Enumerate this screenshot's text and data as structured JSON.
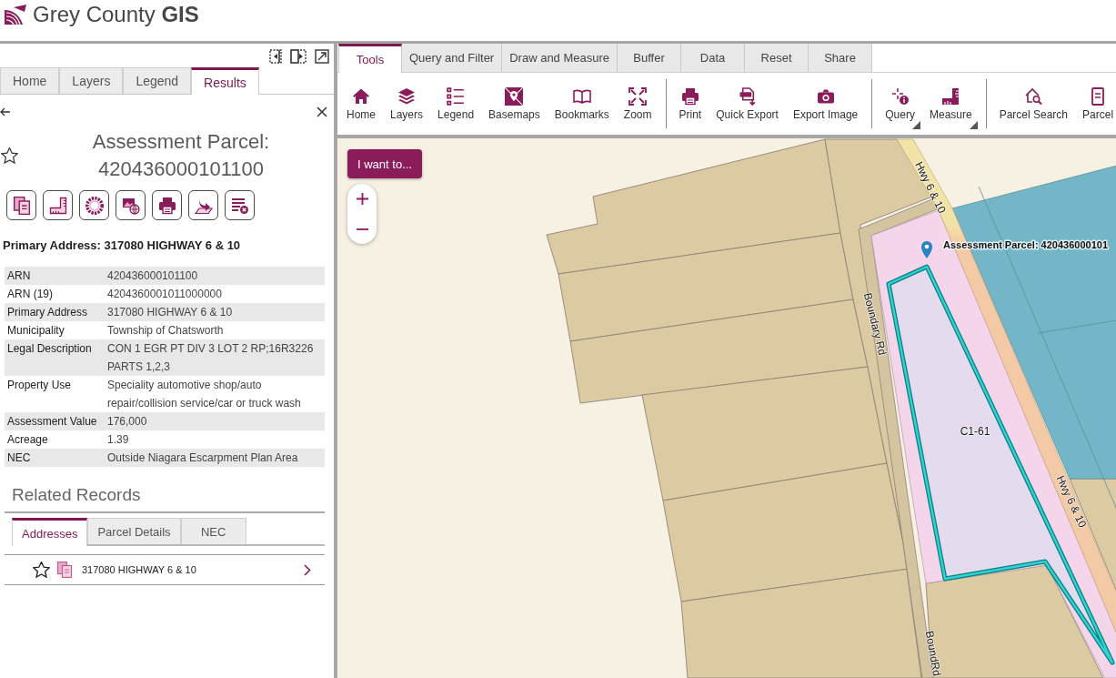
{
  "header": {
    "title": "Grey County **GIS**"
  },
  "side_panel": {
    "tabs": [
      {
        "label": "Home",
        "selected": false
      },
      {
        "label": "Layers",
        "selected": false
      },
      {
        "label": "Legend",
        "selected": false
      },
      {
        "label": "Results",
        "selected": true
      }
    ],
    "record": {
      "title": "Assessment Parcel: 420436000101100",
      "starred": false
    },
    "summary": "Primary Address: 317080 HIGHWAY 6 & 10",
    "attributes": [
      {
        "label": "ARN",
        "value": "420436000101100"
      },
      {
        "label": "ARN (19)",
        "value": "4204360001011000000"
      },
      {
        "label": "Primary Address",
        "value": "317080 HIGHWAY 6 & 10"
      },
      {
        "label": "Municipality",
        "value": "Township of Chatsworth"
      },
      {
        "label": "Legal Description",
        "value": "CON 1 EGR PT DIV 3 LOT 2 RP;16R3226 PARTS 1,2,3"
      },
      {
        "label": "Property Use",
        "value": "Speciality automotive shop/auto repair/collision service/car or truck wash"
      },
      {
        "label": "Assessment Value",
        "value": "176,000"
      },
      {
        "label": "Acreage",
        "value": "1.39"
      },
      {
        "label": "NEC",
        "value": "Outside Niagara Escarpment Plan Area"
      }
    ]
  },
  "related_records": {
    "title": "Related Records",
    "tabs": [
      {
        "label": "Addresses",
        "selected": true
      },
      {
        "label": "Parcel Details",
        "selected": false
      },
      {
        "label": "NEC",
        "selected": false
      }
    ],
    "items": [
      {
        "text": "317080 HIGHWAY 6 & 10",
        "starred": false
      }
    ]
  },
  "toolbar": {
    "tabs": [
      {
        "label": "Tools",
        "selected": true
      },
      {
        "label": "Query and Filter",
        "selected": false
      },
      {
        "label": "Draw and Measure",
        "selected": false
      },
      {
        "label": "Buffer",
        "selected": false
      },
      {
        "label": "Data",
        "selected": false
      },
      {
        "label": "Reset",
        "selected": false
      },
      {
        "label": "Share",
        "selected": false
      }
    ],
    "tool_groups": [
      [
        {
          "label": "Home",
          "menu": false
        },
        {
          "label": "Layers",
          "menu": false
        },
        {
          "label": "Legend",
          "menu": false
        },
        {
          "label": "Basemaps",
          "menu": false
        },
        {
          "label": "Bookmarks",
          "menu": false
        },
        {
          "label": "Zoom",
          "menu": false
        }
      ],
      [
        {
          "label": "Print",
          "menu": false
        },
        {
          "label": "Quick Export",
          "menu": false
        },
        {
          "label": "Export Image",
          "menu": false
        }
      ],
      [
        {
          "label": "Query",
          "menu": true
        },
        {
          "label": "Measure",
          "menu": true
        }
      ],
      [
        {
          "label": "Parcel Search",
          "menu": false
        },
        {
          "label": "Parcel",
          "menu": false
        }
      ]
    ]
  },
  "map": {
    "action_button": "I want to...",
    "labels": [
      {
        "kind": "road",
        "text": "Hwy 6 & 10"
      },
      {
        "kind": "parcel",
        "text": "Assessment Parcel: 420436000101"
      },
      {
        "kind": "road",
        "text": "Boundary Rd"
      },
      {
        "kind": "zone",
        "text": "C1-61"
      },
      {
        "kind": "road",
        "text": "Hwy 6 & 10"
      },
      {
        "kind": "road",
        "text": "BoundRd"
      }
    ]
  }
}
